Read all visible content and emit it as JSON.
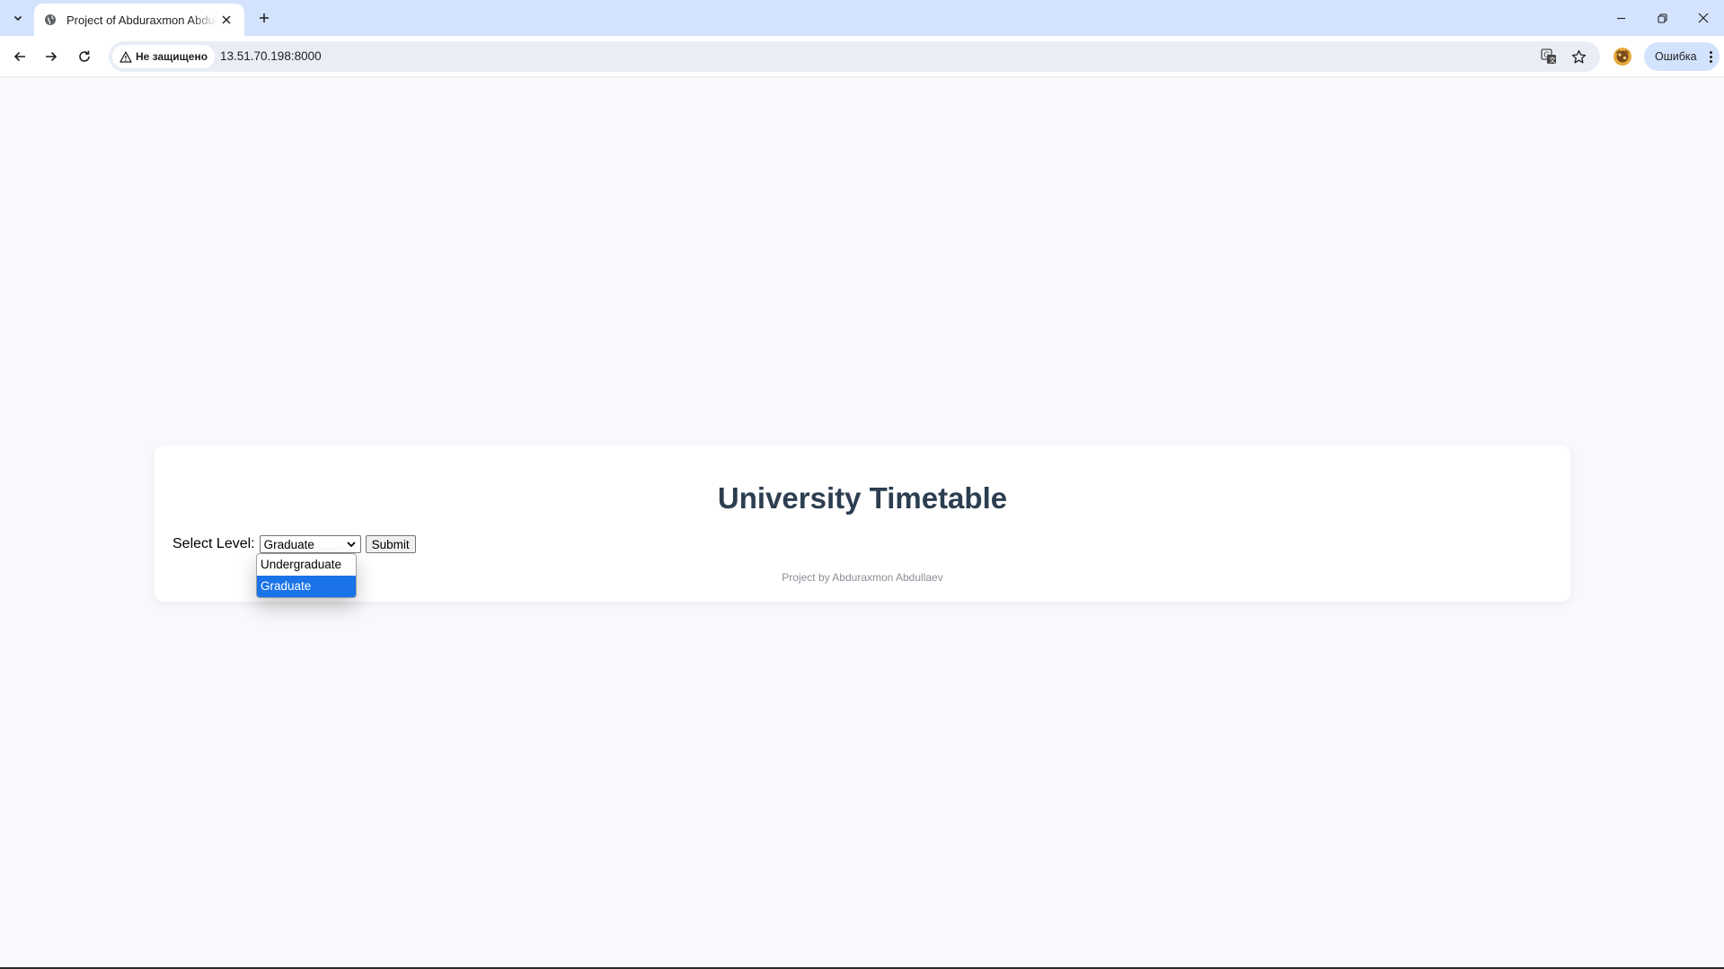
{
  "browser": {
    "tab_title": "Project of Abduraxmon Abdullaev",
    "security_label": "Не защищено",
    "url": "13.51.70.198:8000",
    "profile_label": "Ошибка",
    "icons": {
      "tab_list": "chevron-down-icon",
      "favicon": "globe-icon",
      "tab_close": "close-icon",
      "new_tab": "plus-icon",
      "back": "arrow-left-icon",
      "forward": "arrow-right-icon",
      "reload": "reload-icon",
      "warning": "warning-icon",
      "translate": "translate-icon",
      "bookmark": "star-icon",
      "extension": "extension-icon",
      "menu": "kebab-menu-icon",
      "minimize": "minimize-icon",
      "restore": "restore-icon",
      "close_window": "close-icon"
    }
  },
  "page": {
    "title": "University Timetable",
    "select_label": "Select Level:",
    "select_value": "Graduate",
    "submit_label": "Submit",
    "options": [
      "Undergraduate",
      "Graduate"
    ],
    "highlighted_option": "Graduate",
    "credit": "Project by Abduraxmon Abdullaev"
  },
  "colors": {
    "page_background": "#f8f9fc",
    "title_color": "#2c3e50",
    "highlight": "#1a73e8",
    "tabstrip": "#d3e3fd"
  }
}
